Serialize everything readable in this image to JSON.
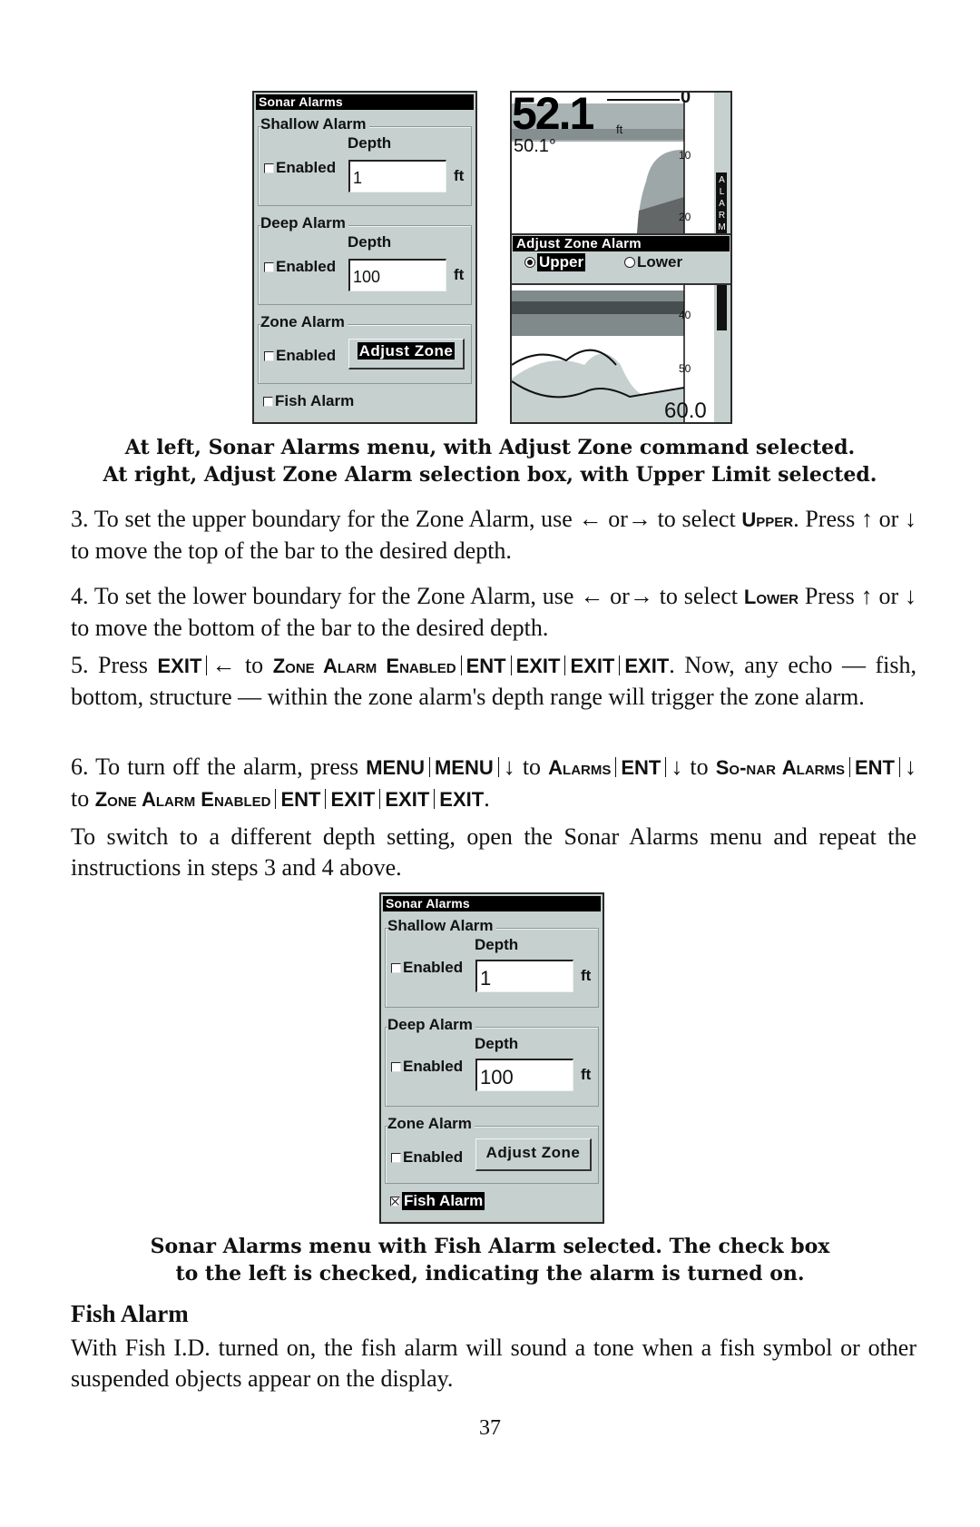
{
  "figure1": {
    "left_panel": {
      "title": "Sonar Alarms",
      "shallow_alarm": {
        "label": "Shallow Alarm",
        "depth_label": "Depth",
        "enabled_label": "Enabled",
        "enabled": false,
        "value": "1",
        "unit": "ft"
      },
      "deep_alarm": {
        "label": "Deep Alarm",
        "depth_label": "Depth",
        "enabled_label": "Enabled",
        "enabled": false,
        "value": "100",
        "unit": "ft"
      },
      "zone_alarm": {
        "label": "Zone Alarm",
        "enabled_label": "Enabled",
        "enabled": false,
        "button": "Adjust Zone",
        "button_selected": true
      },
      "fish_alarm": {
        "label": "Fish Alarm",
        "enabled": false
      }
    },
    "right_panel": {
      "depth": "52.1",
      "depth_unit": "ft",
      "temperature": "50.1°",
      "scale_labels": [
        "0",
        "10",
        "20",
        "40",
        "50"
      ],
      "bottom_range": "60.0",
      "alarm_bar_text": "ALARM",
      "dialog": {
        "title": "Adjust Zone Alarm",
        "options": [
          {
            "label": "Upper",
            "selected": true
          },
          {
            "label": "Lower",
            "selected": false
          }
        ]
      }
    },
    "caption_line1": "At left, Sonar Alarms menu, with Adjust Zone command selected.",
    "caption_line2": "At right, Adjust Zone Alarm selection box, with Upper Limit selected."
  },
  "steps": {
    "s3": {
      "a": "3. To set the upper boundary for the Zone Alarm, use ← or→ to select",
      "key": "Upper",
      "b": ". Press ↑ or ↓ to move the top of the bar to the desired depth."
    },
    "s4": {
      "a": "4. To set the lower boundary for the Zone Alarm, use ← or→ to select",
      "key": "Lower",
      "b": " Press ↑ or ↓ to move the bottom of the bar to the desired depth."
    },
    "s5": {
      "a": "5. Press ",
      "k1": "EXIT",
      "arrow": "←",
      "to": " to ",
      "k2": "Zone Alarm Enabled",
      "k3": "ENT",
      "k4": "EXIT",
      "k5": "EXIT",
      "k6": "EXIT",
      "b": ". Now, any echo — fish, bottom, structure — within the zone alarm's depth range will trigger the zone alarm."
    },
    "s6": {
      "a": "6. To turn off the alarm, press ",
      "k1": "MENU",
      "k2": "MENU",
      "arrow": "↓",
      "to": " to ",
      "k3": "Alarms",
      "k4": "ENT",
      "k5": "So-nar Alarms",
      "k6": "ENT",
      "k7": "Zone Alarm Enabled",
      "k8": "ENT",
      "k9": "EXIT",
      "k10": "EXIT",
      "k11": "EXIT",
      "end": "."
    },
    "switch": "To switch to a different depth setting, open the Sonar Alarms menu and repeat the instructions in steps 3 and 4 above."
  },
  "figure2": {
    "panel": {
      "title": "Sonar Alarms",
      "shallow_alarm": {
        "label": "Shallow Alarm",
        "depth_label": "Depth",
        "enabled_label": "Enabled",
        "enabled": false,
        "value": "1",
        "unit": "ft"
      },
      "deep_alarm": {
        "label": "Deep Alarm",
        "depth_label": "Depth",
        "enabled_label": "Enabled",
        "enabled": false,
        "value": "100",
        "unit": "ft"
      },
      "zone_alarm": {
        "label": "Zone Alarm",
        "enabled_label": "Enabled",
        "enabled": false,
        "button": "Adjust Zone"
      },
      "fish_alarm": {
        "label": "Fish Alarm",
        "enabled": true,
        "selected": true
      }
    },
    "caption_line1": "Sonar Alarms menu with Fish Alarm selected. The check box",
    "caption_line2": "to the left is checked, indicating the alarm is turned on."
  },
  "section": {
    "heading": "Fish Alarm",
    "body": "With Fish I.D. turned on, the fish alarm will sound a tone when a fish symbol or other suspended objects appear on the display."
  },
  "page_number": "37"
}
